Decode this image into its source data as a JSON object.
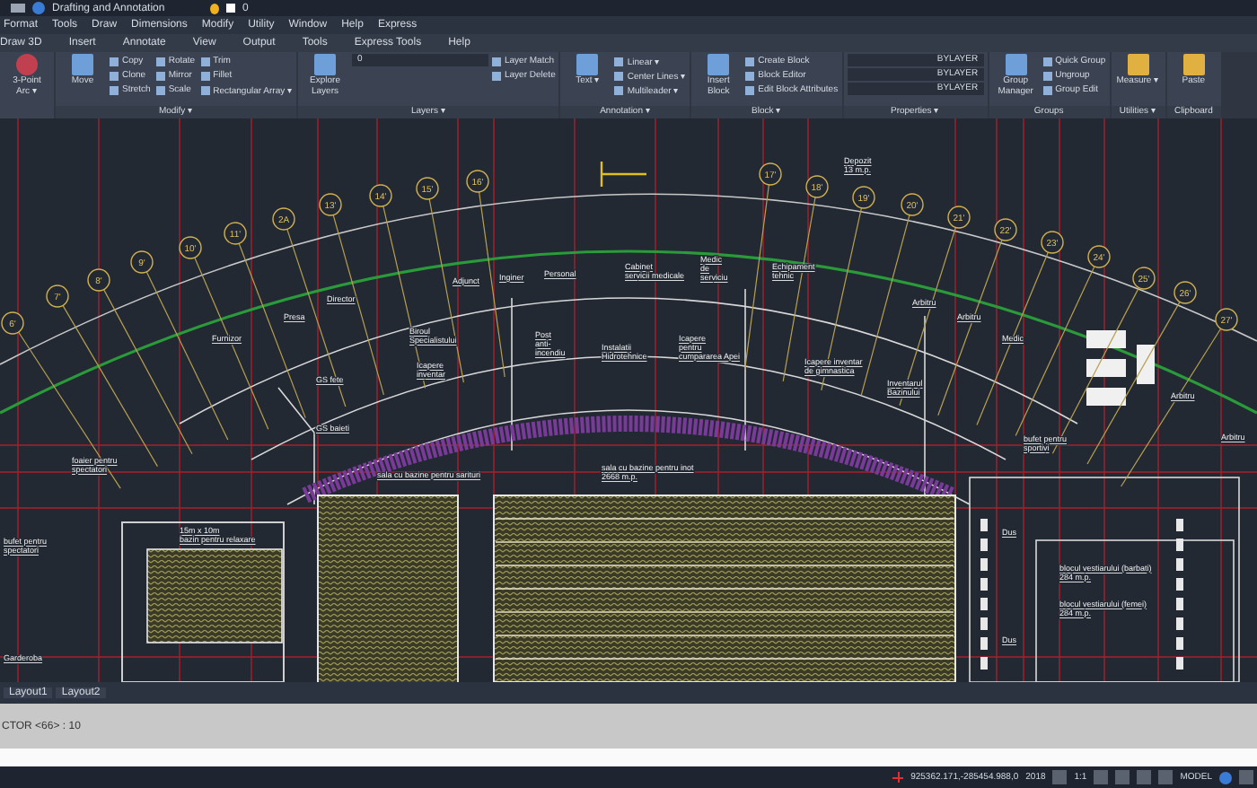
{
  "title_bar": {
    "workspace": "Drafting and Annotation",
    "layer": "0"
  },
  "menu_bar": [
    "Format",
    "Tools",
    "Draw",
    "Dimensions",
    "Modify",
    "Utility",
    "Window",
    "Help",
    "Express"
  ],
  "ribbon_tabs": [
    "Draw 3D",
    "Insert",
    "Annotate",
    "View",
    "Output",
    "Tools",
    "Express Tools",
    "Help"
  ],
  "ribbon_panels": [
    {
      "kind": "draw",
      "large": [
        "3-Point Arc ▾"
      ]
    },
    {
      "kind": "modify",
      "title": "Modify ▾",
      "large": [
        "Move"
      ],
      "small": [
        "Copy",
        "Rotate",
        "Trim",
        "Clone",
        "Mirror",
        "Fillet",
        "Stretch",
        "Scale",
        "Rectangular Array ▾"
      ]
    },
    {
      "kind": "layers",
      "title": "Layers ▾",
      "large": [
        "Explore Layers"
      ],
      "dropdowns": [
        "0"
      ],
      "small": [
        "Layer Match",
        "Layer Delete"
      ]
    },
    {
      "kind": "annotation",
      "title": "Annotation ▾",
      "large": [
        "Text ▾"
      ],
      "small": [
        "Linear ▾",
        "Center Lines ▾",
        "Multileader ▾"
      ]
    },
    {
      "kind": "block",
      "title": "Block ▾",
      "large": [
        "Insert Block"
      ],
      "small": [
        "Create Block",
        "Block Editor",
        "Edit Block Attributes"
      ]
    },
    {
      "kind": "properties",
      "title": "Properties ▾",
      "dropdowns": [
        "BYLAYER",
        "BYLAYER",
        "BYLAYER"
      ]
    },
    {
      "kind": "groups",
      "title": "Groups",
      "large": [
        "Group Manager"
      ],
      "small": [
        "Quick Group",
        "Ungroup",
        "Group Edit"
      ]
    },
    {
      "kind": "utilities",
      "title": "Utilities ▾",
      "large": [
        "Measure ▾"
      ]
    },
    {
      "kind": "clipboard",
      "title": "Clipboard",
      "large": [
        "Paste"
      ]
    }
  ],
  "drawing": {
    "grid_bubbles": [
      "6'",
      "7'",
      "8'",
      "9'",
      "10'",
      "11'",
      "2A",
      "13'",
      "14'",
      "15'",
      "16'",
      "17'",
      "18'",
      "19'",
      "20'",
      "21'",
      "22'",
      "23'",
      "24'",
      "25'",
      "26'",
      "27'"
    ],
    "labels": [
      {
        "lines": [
          "Depozit",
          "13 m.p."
        ]
      },
      {
        "lines": [
          "Furnizor"
        ]
      },
      {
        "lines": [
          "Presa"
        ]
      },
      {
        "lines": [
          "Director"
        ]
      },
      {
        "lines": [
          "Adjunct"
        ]
      },
      {
        "lines": [
          "Inginer"
        ]
      },
      {
        "lines": [
          "Personal"
        ]
      },
      {
        "lines": [
          "Cabinet",
          "servicii medicale"
        ]
      },
      {
        "lines": [
          "Medic",
          "de",
          "serviciu"
        ]
      },
      {
        "lines": [
          "Echipament",
          "tehnic"
        ]
      },
      {
        "lines": [
          "Arbitru"
        ]
      },
      {
        "lines": [
          "Arbitru"
        ]
      },
      {
        "lines": [
          "Medic"
        ]
      },
      {
        "lines": [
          "Arbitru"
        ]
      },
      {
        "lines": [
          "Arbitru"
        ]
      },
      {
        "lines": [
          "Biroul",
          "Specialistului"
        ]
      },
      {
        "lines": [
          "Icapere",
          "inventar"
        ]
      },
      {
        "lines": [
          "GS fete"
        ]
      },
      {
        "lines": [
          "GS baieti"
        ]
      },
      {
        "lines": [
          "Post",
          "anti-",
          "incendiu"
        ]
      },
      {
        "lines": [
          "Instalatii",
          "Hidrotehnice"
        ]
      },
      {
        "lines": [
          "Icapere",
          "pentru",
          "cumpararea Apei"
        ]
      },
      {
        "lines": [
          "Icapere inventar",
          "de gimnastica"
        ]
      },
      {
        "lines": [
          "Inventarul",
          "Bazinului"
        ]
      },
      {
        "lines": [
          "foaier pentru",
          "spectatori"
        ]
      },
      {
        "lines": [
          "sala cu bazine pentru sarituri"
        ]
      },
      {
        "lines": [
          "sala cu bazine pentru inot",
          "2668 m.p."
        ]
      },
      {
        "lines": [
          "bufet pentru",
          "sportivi"
        ]
      },
      {
        "lines": [
          "15m x 10m",
          "bazin pentru relaxare"
        ]
      },
      {
        "lines": [
          "bufet pentru",
          "spectatori"
        ]
      },
      {
        "lines": [
          "Dus"
        ]
      },
      {
        "lines": [
          "Dus"
        ]
      },
      {
        "lines": [
          "blocul vestiarului (barbati)",
          "284 m.p."
        ]
      },
      {
        "lines": [
          "blocul vestiarului (femei)",
          "284 m.p."
        ]
      },
      {
        "lines": [
          "Garderoba"
        ]
      }
    ]
  },
  "layout_tabs": [
    "Layout1",
    "Layout2"
  ],
  "command_line": "CTOR <66> : 10",
  "status_bar": {
    "coordinates": "925362.171,-285454.988,0",
    "year": "2018",
    "scale": "1:1",
    "space": "MODEL"
  }
}
